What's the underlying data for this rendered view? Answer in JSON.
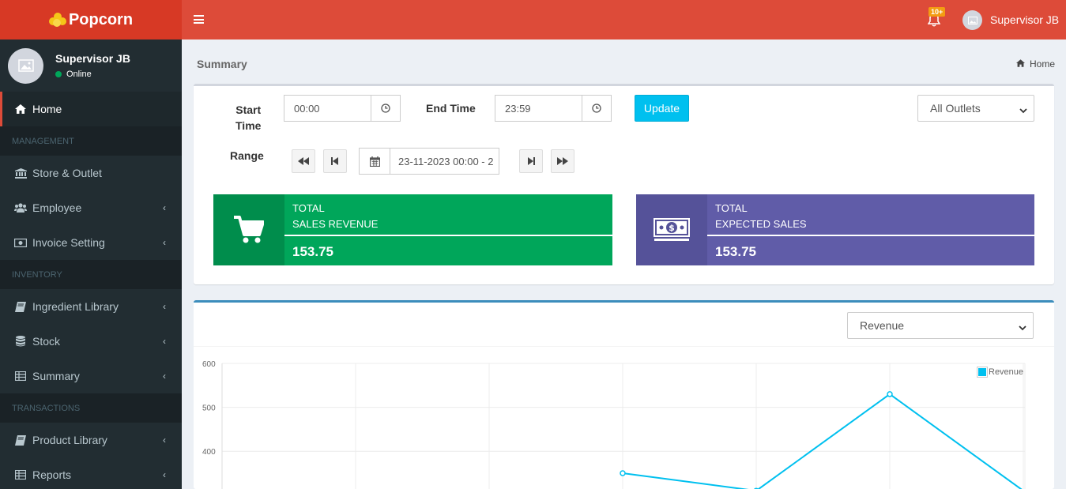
{
  "app": {
    "name": "Popcorn"
  },
  "sidebar": {
    "user": {
      "name": "Supervisor JB",
      "status": "Online"
    },
    "items": [
      {
        "label": "Home",
        "icon": "home-icon"
      },
      {
        "header": "MANAGEMENT"
      },
      {
        "label": "Store & Outlet",
        "icon": "bank-icon"
      },
      {
        "label": "Employee",
        "icon": "users-icon"
      },
      {
        "label": "Invoice Setting",
        "icon": "money-icon"
      },
      {
        "header": "INVENTORY"
      },
      {
        "label": "Ingredient Library",
        "icon": "book-icon"
      },
      {
        "label": "Stock",
        "icon": "database-icon"
      },
      {
        "label": "Summary",
        "icon": "table-icon"
      },
      {
        "header": "TRANSACTIONS"
      },
      {
        "label": "Product Library",
        "icon": "book-icon"
      },
      {
        "label": "Reports",
        "icon": "table-icon"
      }
    ]
  },
  "topbar": {
    "notification_badge": "10+",
    "user_name": "Supervisor JB"
  },
  "page": {
    "title": "Summary",
    "breadcrumb": "Home"
  },
  "filters": {
    "start_time_label": "Start Time",
    "start_time_line1": "Start",
    "start_time_line2": "Time",
    "start_time": "00:00",
    "end_time_label": "End Time",
    "end_time": "23:59",
    "update_label": "Update",
    "outlet_selected": "All Outlets",
    "range_label": "Range",
    "range_value": "23-11-2023 00:00 - 2"
  },
  "cards": {
    "revenue": {
      "line1": "TOTAL",
      "line2": "SALES REVENUE",
      "value": "153.75",
      "color": "#00a65a"
    },
    "expected": {
      "line1": "TOTAL",
      "line2": "EXPECTED SALES",
      "value": "153.75",
      "color": "#605ca8"
    }
  },
  "chart_select": {
    "selected": "Revenue"
  },
  "chart_data": {
    "type": "line",
    "y_ticks": [
      "600",
      "500",
      "400"
    ],
    "series": [
      {
        "name": "Revenue",
        "color": "#00c0ef",
        "values": [
          null,
          null,
          null,
          350,
          310,
          530,
          310
        ]
      }
    ],
    "ylim": [
      300,
      600
    ],
    "grid": true,
    "legend": "top-right"
  }
}
